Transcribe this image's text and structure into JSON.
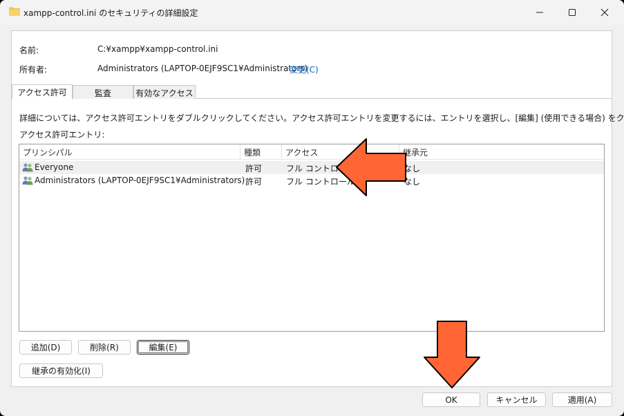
{
  "window": {
    "title": "xampp-control.ini のセキュリティの詳細設定"
  },
  "info": {
    "name_label": "名前:",
    "name_value": "C:¥xampp¥xampp-control.ini",
    "owner_label": "所有者:",
    "owner_value": "Administrators (LAPTOP-0EJF9SC1¥Administrators)",
    "change_link": "変更(C)"
  },
  "tabs": [
    {
      "label": "アクセス許可",
      "active": true
    },
    {
      "label": "監査",
      "active": false
    },
    {
      "label": "有効なアクセス",
      "active": false
    }
  ],
  "description": "詳細については、アクセス許可エントリをダブルクリックしてください。アクセス許可エントリを変更するには、エントリを選択し、[編集] (使用できる場合) をクリックします。",
  "entries_label": "アクセス許可エントリ:",
  "table": {
    "columns": [
      "プリンシパル",
      "種類",
      "アクセス",
      "継承元"
    ],
    "rows": [
      {
        "principal": "Everyone",
        "type": "許可",
        "access": "フル コントロール",
        "inherited": "なし"
      },
      {
        "principal": "Administrators (LAPTOP-0EJF9SC1¥Administrators)",
        "type": "許可",
        "access": "フル コントロール",
        "inherited": "なし"
      }
    ]
  },
  "buttons": {
    "add": "追加(D)",
    "remove": "削除(R)",
    "edit": "編集(E)",
    "enable_inheritance": "継承の有効化(I)",
    "ok": "OK",
    "cancel": "キャンセル",
    "apply": "適用(A)"
  },
  "colors": {
    "annotation_arrow": "#ff6633",
    "link": "#0a64c8"
  },
  "icons": {
    "title": "folder-icon",
    "principal": "users-icon"
  }
}
